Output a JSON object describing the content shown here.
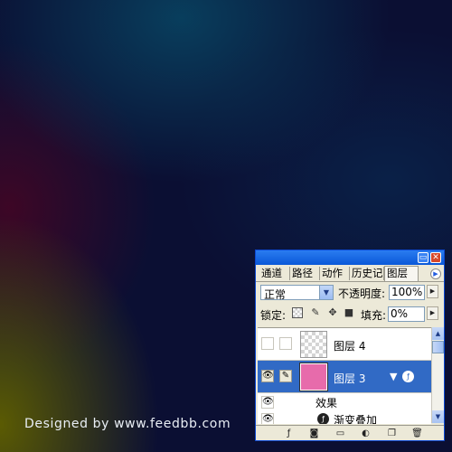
{
  "watermark": "Designed by www.feedbb.com",
  "panel": {
    "tabs": [
      "通道",
      "路径",
      "动作",
      "历史记",
      "图层"
    ],
    "active_tab": "图层",
    "blend_mode": "正常",
    "opacity_label": "不透明度:",
    "opacity_value": "100%",
    "lock_label": "锁定:",
    "fill_label": "填充:",
    "fill_value": "0%",
    "layers": [
      {
        "name": "图层 4",
        "visible": false,
        "selected": false
      },
      {
        "name": "图层 3",
        "visible": true,
        "selected": true,
        "has_effects": true
      }
    ],
    "effects_label": "效果",
    "effect_name": "渐变叠加"
  },
  "colors": {
    "selection": "#316ac5",
    "layer3_thumb": "#e76bab",
    "titlebar": "#0a58d8"
  }
}
